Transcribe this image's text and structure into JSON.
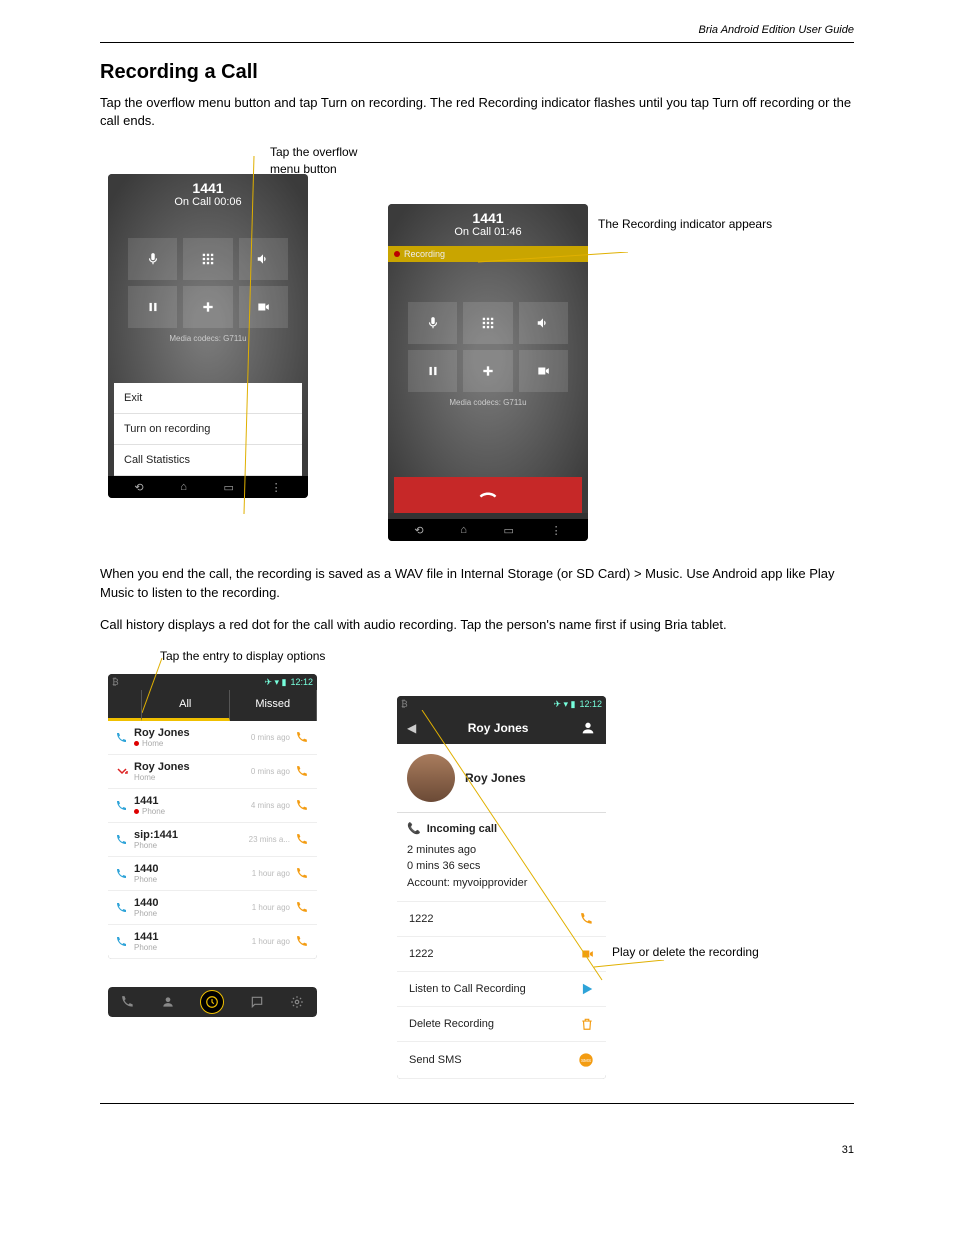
{
  "header_right": "Bria Android Edition User Guide",
  "section1": {
    "title": "Recording a Call",
    "para": "Tap the overflow menu button and tap Turn on recording. The red Recording indicator flashes until you tap Turn off recording or the call ends.",
    "callout1": "Tap the overflow\nmenu button",
    "callout2": "The Recording indicator appears"
  },
  "phone1": {
    "title": "1441",
    "sub": "On Call  00:06",
    "codec": "Media codecs: G711u",
    "menu": [
      "Exit",
      "Turn on recording",
      "Call Statistics"
    ]
  },
  "phone2": {
    "title": "1441",
    "sub": "On Call  01:46",
    "recording": "Recording",
    "codec": "Media codecs: G711u"
  },
  "section2": {
    "para1": "When you end the call, the recording is saved as a WAV file in Internal Storage (or SD Card) > Music. Use Android app like Play Music to listen to the recording.",
    "para2": "Call history displays a red dot for the call with audio recording. Tap the person's name first if using Bria tablet.",
    "callout3": "Tap the entry to display options",
    "callout4": "Play or delete the recording"
  },
  "phone3": {
    "status_time": "12:12",
    "tabs": [
      "",
      "All",
      "Missed"
    ],
    "rows": [
      {
        "name": "Roy Jones",
        "sub": "Home",
        "time": "0 mins ago",
        "type": "in",
        "rec": true
      },
      {
        "name": "Roy Jones",
        "sub": "Home",
        "time": "0 mins ago",
        "type": "missed"
      },
      {
        "name": "1441",
        "sub": "Phone",
        "time": "4 mins ago",
        "type": "out",
        "rec": true
      },
      {
        "name": "sip:1441",
        "sub": "Phone",
        "time": "23 mins a...",
        "type": "out"
      },
      {
        "name": "1440",
        "sub": "Phone",
        "time": "1 hour ago",
        "type": "out"
      },
      {
        "name": "1440",
        "sub": "Phone",
        "time": "1 hour ago",
        "type": "in"
      },
      {
        "name": "1441",
        "sub": "Phone",
        "time": "1 hour ago",
        "type": "out"
      }
    ]
  },
  "phone4": {
    "status_time": "12:12",
    "title": "Roy Jones",
    "person_name": "Roy Jones",
    "incoming": "Incoming call",
    "line1": "2 minutes ago",
    "line2": "0 mins 36 secs",
    "line3": "Account: myvoipprovider",
    "rows": [
      {
        "label": "1222",
        "icon": "phone"
      },
      {
        "label": "1222",
        "icon": "video"
      },
      {
        "label": "Listen to Call Recording",
        "icon": "play"
      },
      {
        "label": "Delete Recording",
        "icon": "trash"
      },
      {
        "label": "Send SMS",
        "icon": "sms"
      }
    ]
  },
  "footer_page": "31"
}
